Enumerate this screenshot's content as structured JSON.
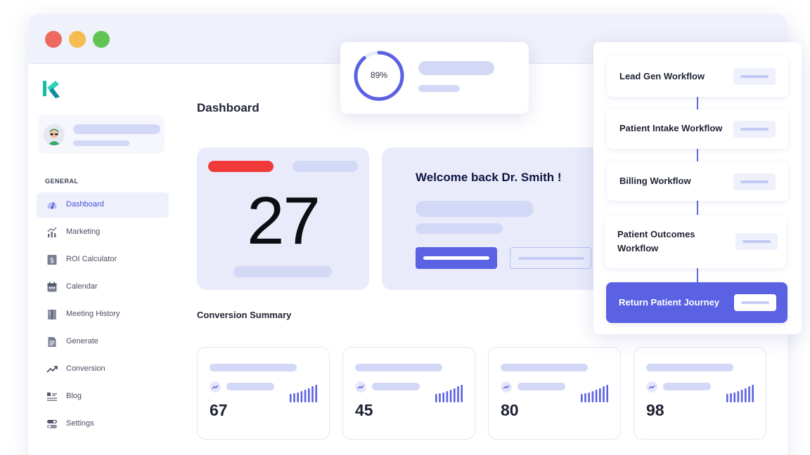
{
  "sidebar": {
    "section_label": "GENERAL",
    "items": [
      {
        "label": "Dashboard",
        "icon": "gauge-icon",
        "active": true
      },
      {
        "label": "Marketing",
        "icon": "chart-icon"
      },
      {
        "label": "ROI Calculator",
        "icon": "dollar-icon"
      },
      {
        "label": "Calendar",
        "icon": "calendar-icon"
      },
      {
        "label": "Meeting History",
        "icon": "book-icon"
      },
      {
        "label": "Generate",
        "icon": "document-icon"
      },
      {
        "label": "Conversion",
        "icon": "trend-up-icon"
      },
      {
        "label": "Blog",
        "icon": "list-icon"
      },
      {
        "label": "Settings",
        "icon": "toggle-icon"
      }
    ]
  },
  "main": {
    "title": "Dashboard",
    "big_count": "27",
    "welcome": "Welcome back Dr. Smith !",
    "conversion_title": "Conversion Summary",
    "stats": [
      {
        "value": "67"
      },
      {
        "value": "45"
      },
      {
        "value": "80"
      },
      {
        "value": "98"
      }
    ]
  },
  "progress": {
    "label": "89%",
    "value": 0.89
  },
  "workflows": [
    {
      "label": "Lead Gen Workflow"
    },
    {
      "label": "Patient Intake Workflow"
    },
    {
      "label": "Billing Workflow"
    },
    {
      "label": "Patient Outcomes Workflow"
    },
    {
      "label": "Return Patient Journey",
      "highlight": true
    }
  ],
  "colors": {
    "accent": "#5a61e3",
    "placeholder": "#d3d8f7",
    "alert": "#f03a3a",
    "card_bg": "#e9ebfb"
  }
}
